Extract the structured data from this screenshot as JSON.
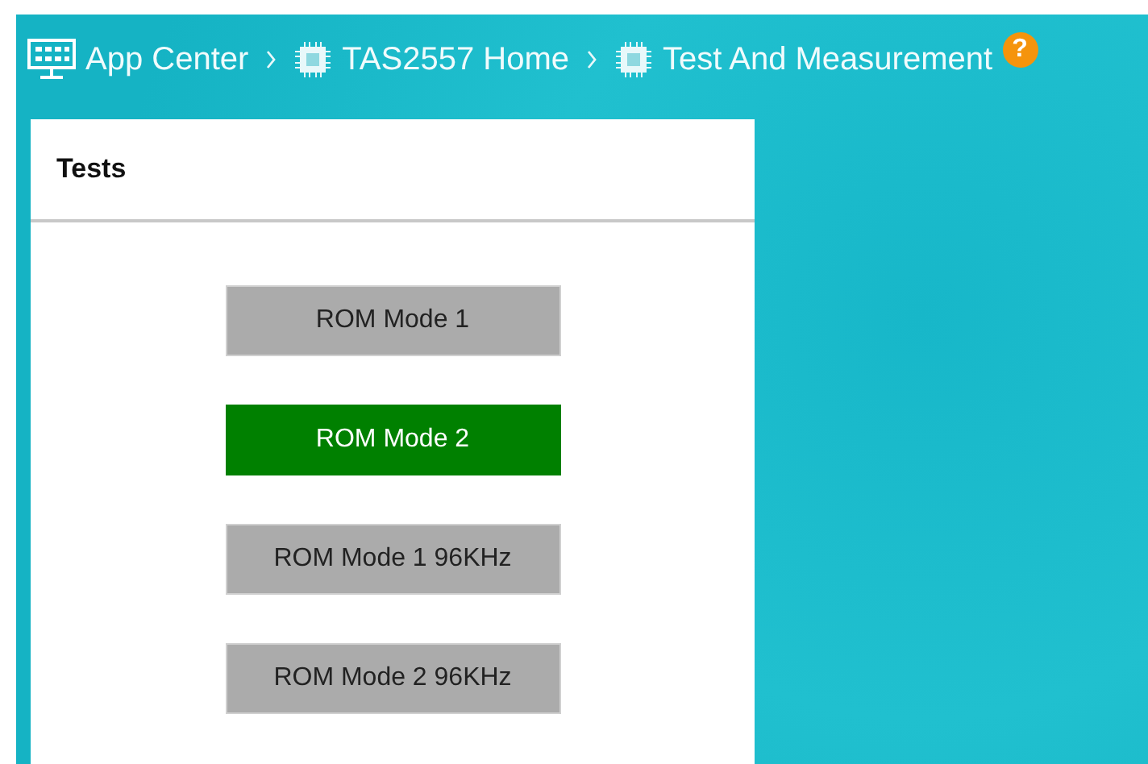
{
  "breadcrumbs": [
    {
      "label": "App Center",
      "kind": "monitor"
    },
    {
      "label": "TAS2557 Home",
      "kind": "chip"
    },
    {
      "label": "Test And Measurement",
      "kind": "chip"
    }
  ],
  "help": "?",
  "panel": {
    "title": "Tests",
    "buttons": [
      {
        "label": "ROM Mode 1",
        "selected": false
      },
      {
        "label": "ROM Mode 2",
        "selected": true
      },
      {
        "label": "ROM Mode 1 96KHz",
        "selected": false
      },
      {
        "label": "ROM Mode 2 96KHz",
        "selected": false
      }
    ]
  }
}
